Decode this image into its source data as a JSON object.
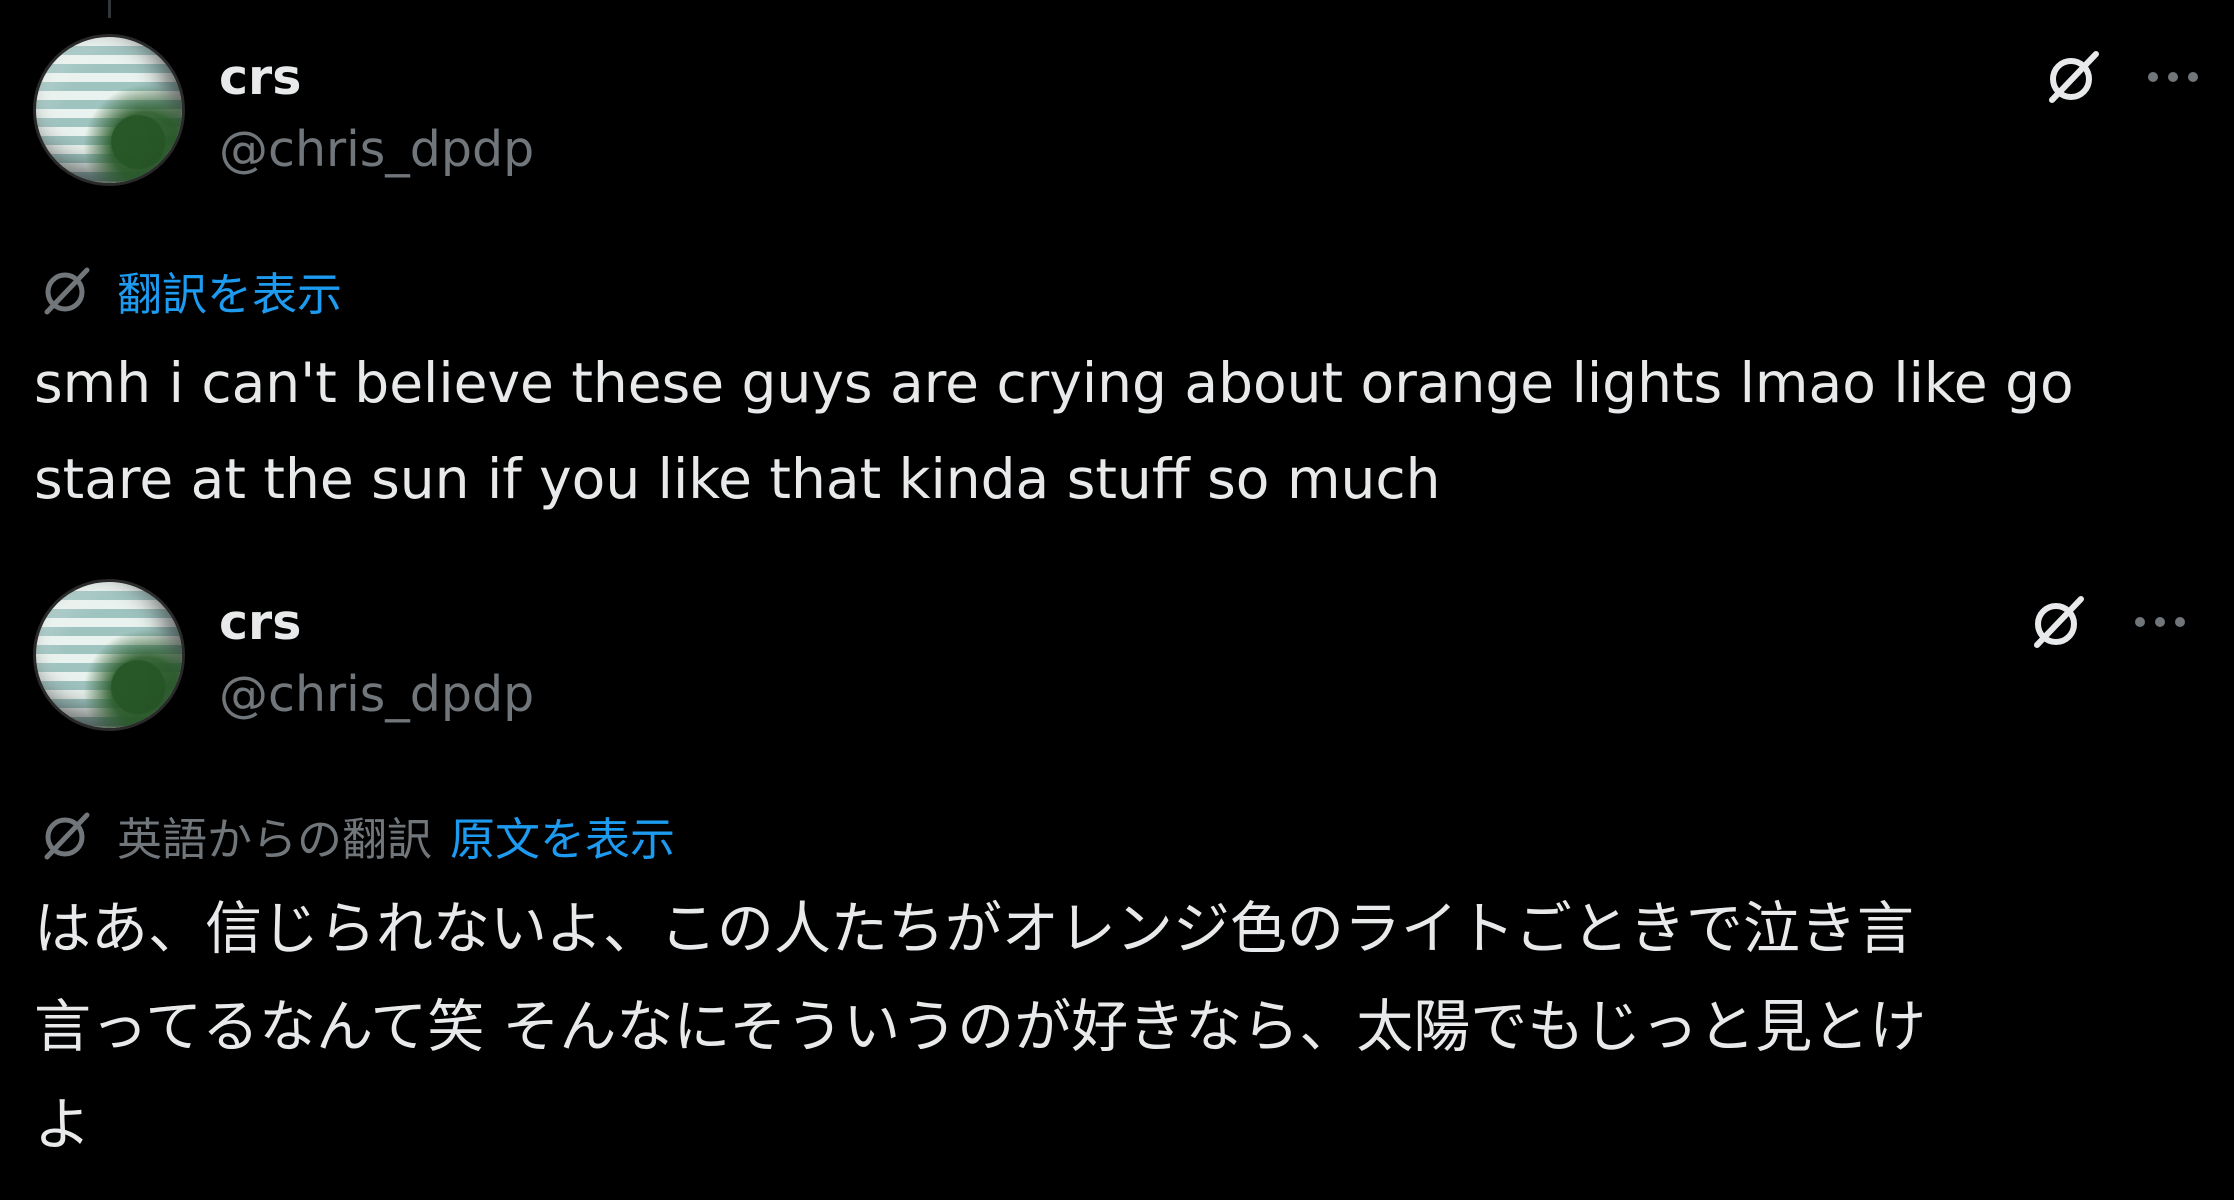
{
  "posts": [
    {
      "author_name": "crs",
      "author_handle": "@chris_dpdp",
      "translation_link": "翻訳を表示",
      "translation_meta": "",
      "body": "smh i can't believe these guys are crying about orange lights lmao like go\nstare at the sun if you like that kinda stuff so much"
    },
    {
      "author_name": "crs",
      "author_handle": "@chris_dpdp",
      "translation_meta": "英語からの翻訳",
      "translation_link": "原文を表示",
      "body": "はあ、信じられないよ、この人たちがオレンジ色のライトごときで泣き言\n言ってるなんて笑 そんなにそういうのが好きなら、太陽でもじっと見とけ\nよ"
    }
  ],
  "icons": {
    "grok": "grok-icon",
    "more": "more-icon",
    "translate": "translate-icon"
  },
  "colors": {
    "background": "#000000",
    "text": "#e7e9ea",
    "secondary": "#71767b",
    "link": "#1d9bf0"
  }
}
